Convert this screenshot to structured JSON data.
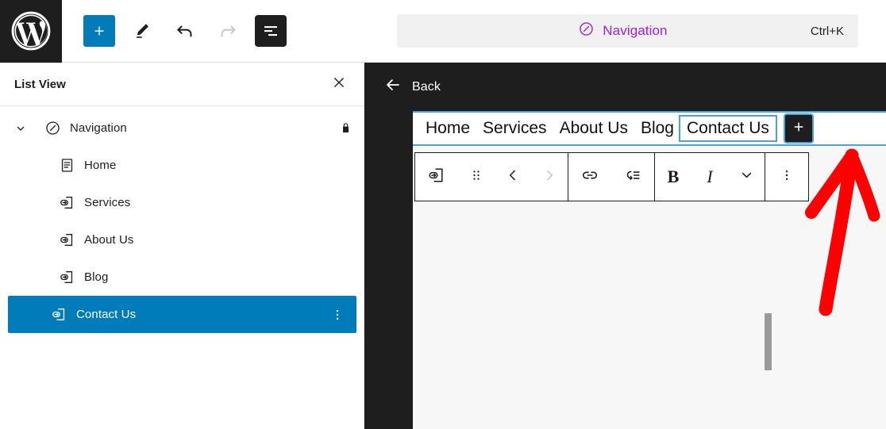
{
  "app": {
    "name": "WordPress Block Editor",
    "accent_blue": "#007cba",
    "dark": "#1e1e1e",
    "purple": "#a020d0",
    "annotation_color": "#ff0000"
  },
  "topbar": {
    "logo_icon": "wordpress-logo-icon",
    "buttons": [
      {
        "icon": "plus-icon",
        "label": "Toggle block inserter",
        "state": "primary"
      },
      {
        "icon": "pencil-icon",
        "label": "Tools",
        "state": "default"
      },
      {
        "icon": "undo-arrow-icon",
        "label": "Undo",
        "state": "default"
      },
      {
        "icon": "redo-arrow-icon",
        "label": "Redo",
        "state": "disabled"
      },
      {
        "icon": "list-view-icon",
        "label": "List View",
        "state": "active"
      }
    ],
    "command_palette": {
      "icon": "navigation-circle-slash-icon",
      "label": "Navigation",
      "shortcut": "Ctrl+K"
    }
  },
  "list_view": {
    "title": "List View",
    "close_icon": "close-x-icon",
    "root": {
      "chevron_icon": "chevron-down-icon",
      "block_icon": "navigation-circle-slash-icon",
      "label": "Navigation",
      "trailing_icon": "lock-icon",
      "expanded": true
    },
    "items": [
      {
        "block_icon": "page-document-icon",
        "label": "Home",
        "selected": false,
        "menu_icon": ""
      },
      {
        "block_icon": "custom-link-icon",
        "label": "Services",
        "selected": false,
        "menu_icon": ""
      },
      {
        "block_icon": "custom-link-icon",
        "label": "About Us",
        "selected": false,
        "menu_icon": ""
      },
      {
        "block_icon": "custom-link-icon",
        "label": "Blog",
        "selected": false,
        "menu_icon": ""
      },
      {
        "block_icon": "custom-link-icon",
        "label": "Contact Us",
        "selected": true,
        "menu_icon": "more-vertical-icon"
      }
    ]
  },
  "editor": {
    "back": {
      "icon": "arrow-left-icon",
      "label": "Back"
    },
    "nav_block": {
      "items": [
        {
          "label": "Home",
          "selected": false
        },
        {
          "label": "Services",
          "selected": false
        },
        {
          "label": "About Us",
          "selected": false
        },
        {
          "label": "Blog",
          "selected": false
        },
        {
          "label": "Contact Us",
          "selected": true
        }
      ],
      "appender": {
        "icon": "plus-icon",
        "label": "Add block"
      }
    },
    "block_toolbar": {
      "groups": [
        [
          {
            "icon": "custom-link-block-icon",
            "label": "Custom Link",
            "state": "default"
          },
          {
            "icon": "drag-handle-icon",
            "label": "Drag",
            "state": "default"
          },
          {
            "icon": "move-left-icon",
            "label": "Move left",
            "state": "default"
          },
          {
            "icon": "move-right-icon",
            "label": "Move right",
            "state": "disabled"
          }
        ],
        [
          {
            "icon": "link-icon",
            "label": "Link",
            "state": "default"
          },
          {
            "icon": "add-submenu-icon",
            "label": "Add submenu",
            "state": "default"
          }
        ],
        [
          {
            "icon": "bold-icon",
            "label": "B",
            "state": "default"
          },
          {
            "icon": "italic-icon",
            "label": "I",
            "state": "default"
          },
          {
            "icon": "chevron-down-icon",
            "label": "More",
            "state": "default"
          }
        ],
        [
          {
            "icon": "more-vertical-icon",
            "label": "Options",
            "state": "default"
          }
        ]
      ]
    },
    "scrollbar": {
      "label": "Canvas vertical scrollbar"
    }
  },
  "annotation": {
    "type": "arrow",
    "color": "#ff0000",
    "points_to": "nav-block-appender-plus-button"
  }
}
